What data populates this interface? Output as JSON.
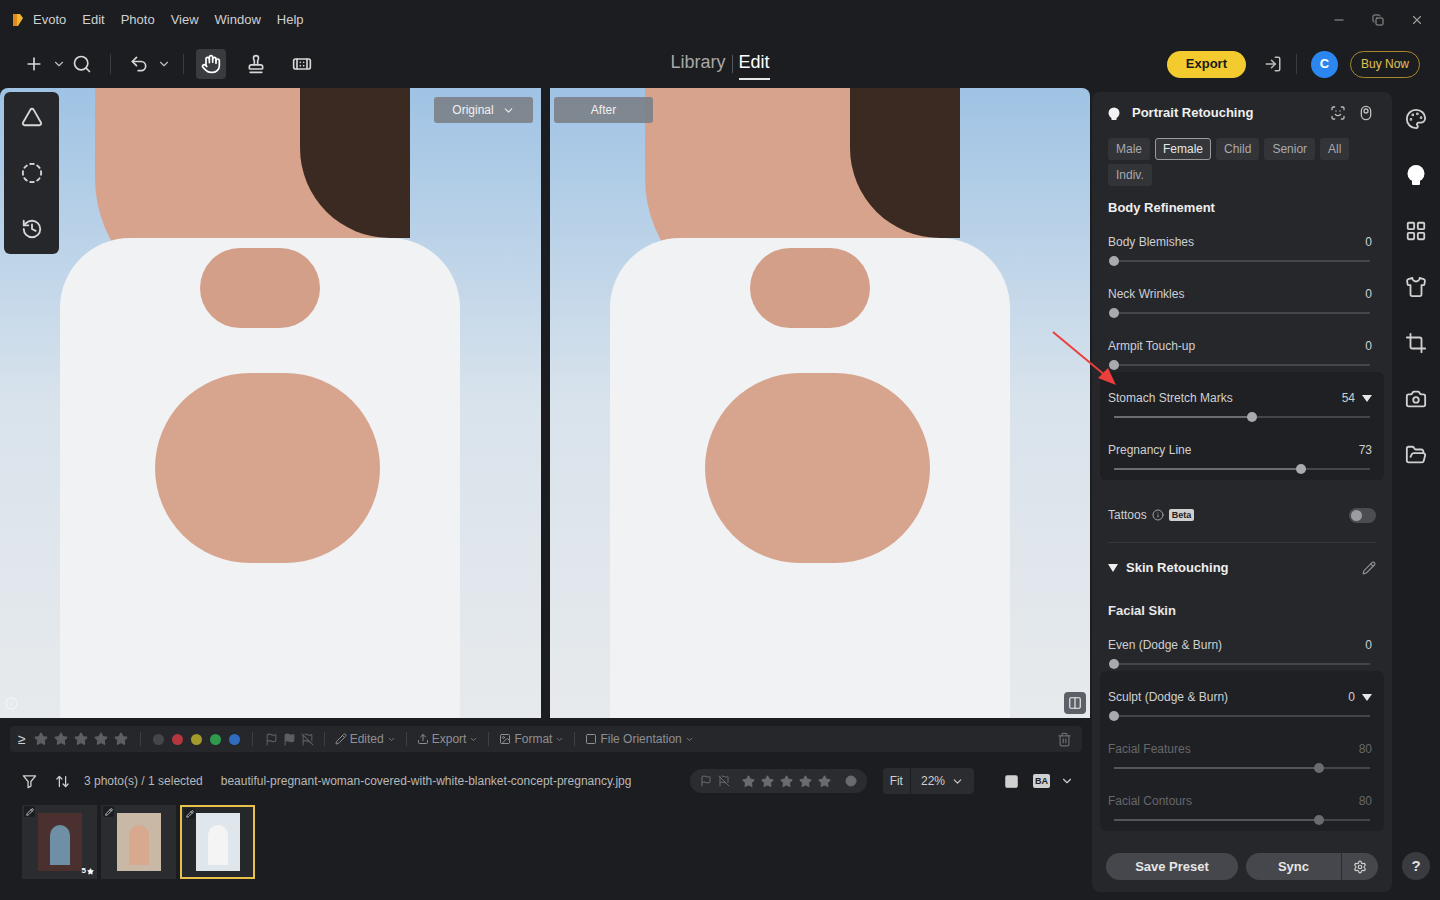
{
  "window": {
    "app_menu": [
      "Evoto",
      "Edit",
      "Photo",
      "View",
      "Window",
      "Help"
    ]
  },
  "toolbar": {
    "tools": [
      {
        "kind": "add",
        "menu": true,
        "selected": false
      },
      {
        "kind": "search",
        "menu": false,
        "selected": false
      },
      {
        "kind": "undo",
        "menu": true,
        "selected": false
      },
      {
        "kind": "hand",
        "menu": false,
        "selected": true
      },
      {
        "kind": "clone",
        "menu": false,
        "selected": false
      },
      {
        "kind": "heal",
        "menu": false,
        "selected": false
      }
    ],
    "modes": [
      {
        "label": "Library",
        "selected": false
      },
      {
        "label": "Edit",
        "selected": true
      }
    ],
    "export_button": "Export",
    "avatar": "C",
    "buy_button": "Buy Now"
  },
  "side_tools": [
    {
      "kind": "mask",
      "selected": false
    },
    {
      "kind": "select",
      "selected": false
    },
    {
      "kind": "history",
      "selected": false
    }
  ],
  "canvas": {
    "panes": [
      {
        "label": "Original",
        "dropdown": true
      },
      {
        "label": "After",
        "dropdown": false
      }
    ]
  },
  "panel": {
    "title": "Portrait Retouching",
    "filters": [
      {
        "label": "Male",
        "selected": false
      },
      {
        "label": "Female",
        "selected": true
      },
      {
        "label": "Child",
        "selected": false
      },
      {
        "label": "Senior",
        "selected": false
      },
      {
        "label": "All",
        "selected": false
      },
      {
        "label": "Indiv.",
        "selected": false
      }
    ],
    "sections": [
      {
        "title": "Body Refinement",
        "collapsible": false,
        "items": [
          {
            "kind": "slider",
            "label": "Body Blemishes",
            "value": "0",
            "level": 0,
            "dropdown": false,
            "disabled": false
          },
          {
            "kind": "slider",
            "label": "Neck Wrinkles",
            "value": "0",
            "level": 0,
            "dropdown": false,
            "disabled": false
          },
          {
            "kind": "slider",
            "label": "Armpit Touch-up",
            "value": "0",
            "level": 0,
            "dropdown": false,
            "disabled": false
          },
          {
            "kind": "group",
            "items": [
              {
                "kind": "slider",
                "label": "Stomach Stretch Marks",
                "value": "54",
                "level": 0.54,
                "dropdown": true,
                "disabled": false
              },
              {
                "kind": "slider",
                "label": "Pregnancy Line",
                "value": "73",
                "level": 0.73,
                "dropdown": false,
                "disabled": false
              }
            ]
          },
          {
            "kind": "toggle",
            "label": "Tattoos",
            "badge": "Beta",
            "on": false
          }
        ]
      },
      {
        "title": "Skin Retouching",
        "collapsible": true,
        "expanded": true,
        "items": [
          {
            "kind": "subheading",
            "label": "Facial Skin"
          },
          {
            "kind": "slider",
            "label": "Even (Dodge & Burn)",
            "value": "0",
            "level": 0,
            "dropdown": false,
            "disabled": false
          },
          {
            "kind": "group",
            "items": [
              {
                "kind": "slider",
                "label": "Sculpt (Dodge & Burn)",
                "value": "0",
                "level": 0,
                "dropdown": true,
                "disabled": false
              },
              {
                "kind": "slider",
                "label": "Facial Features",
                "value": "80",
                "level": 0.8,
                "dropdown": false,
                "disabled": true
              },
              {
                "kind": "slider",
                "label": "Facial Contours",
                "value": "80",
                "level": 0.8,
                "dropdown": false,
                "disabled": true
              }
            ]
          }
        ]
      }
    ],
    "save_button": "Save Preset",
    "sync_button": "Sync"
  },
  "rail": {
    "items": [
      {
        "kind": "palette",
        "selected": false
      },
      {
        "kind": "portrait",
        "selected": true
      },
      {
        "kind": "background",
        "selected": false
      },
      {
        "kind": "clothes",
        "selected": false
      },
      {
        "kind": "crop",
        "selected": false
      },
      {
        "kind": "camera",
        "selected": false
      },
      {
        "kind": "folder",
        "selected": false
      }
    ],
    "help": "?"
  },
  "filter_bar": {
    "operator": "≥",
    "stars": 0,
    "colors": [
      {
        "color": "#45464a"
      },
      {
        "color": "#b4363e"
      },
      {
        "color": "#a39a2c"
      },
      {
        "color": "#2f9a4c"
      },
      {
        "color": "#2f6cc0"
      }
    ],
    "menus": [
      {
        "label": "Edited",
        "kind": "edited"
      },
      {
        "label": "Export",
        "kind": "export"
      },
      {
        "label": "Format",
        "kind": "format"
      },
      {
        "label": "File Orientation",
        "kind": "orientation"
      }
    ]
  },
  "status_bar": {
    "count": "3 photo(s) / 1 selected",
    "filename": "beautiful-pregnant-woman-covered-with-white-blanket-concept-pregnancy.jpg",
    "stars": 0,
    "fit": "Fit",
    "zoom": "22%",
    "compare": "BA"
  },
  "filmstrip": [
    {
      "edited": true,
      "badge": "5",
      "selected": false
    },
    {
      "edited": true,
      "badge": "",
      "selected": false
    },
    {
      "edited": true,
      "badge": "",
      "selected": true
    }
  ]
}
